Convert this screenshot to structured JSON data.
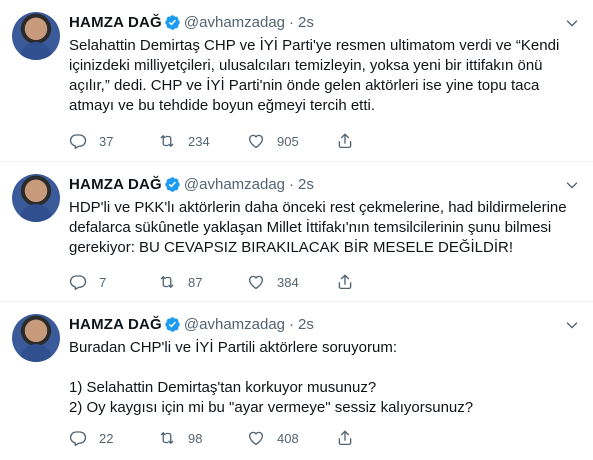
{
  "tweets": [
    {
      "name": "HAMZA DAĞ",
      "handle": "@avhamzadag",
      "dot": "·",
      "time": "2s",
      "text": "Selahattin Demirtaş CHP ve İYİ Parti'ye resmen ultimatom verdi ve “Kendi içinizdeki milliyetçileri, ulusalcıları temizleyin, yoksa yeni bir ittifakın önü açılır,” dedi. CHP ve İYİ Parti'nin önde gelen aktörleri ise yine topu taca atmayı ve bu tehdide boyun eğmeyi tercih etti.",
      "replies": "37",
      "retweets": "234",
      "likes": "905"
    },
    {
      "name": "HAMZA DAĞ",
      "handle": "@avhamzadag",
      "dot": "·",
      "time": "2s",
      "text": "HDP'li ve PKK'lı aktörlerin daha önceki rest çekmelerine, had bildirmelerine defalarca sükûnetle yaklaşan Millet İttifakı'nın temsilcilerinin şunu bilmesi gerekiyor: BU CEVAPSIZ BIRAKILACAK BİR MESELE DEĞİLDİR!",
      "replies": "7",
      "retweets": "87",
      "likes": "384"
    },
    {
      "name": "HAMZA DAĞ",
      "handle": "@avhamzadag",
      "dot": "·",
      "time": "2s",
      "text": "Buradan CHP'li ve İYİ Partili aktörlere soruyorum:\n\n1) Selahattin Demirtaş'tan korkuyor musunuz?\n2) Oy kaygısı için mi bu \"ayar vermeye\" sessiz kalıyorsunuz?",
      "replies": "22",
      "retweets": "98",
      "likes": "408"
    }
  ],
  "icons": {
    "verified": "verified-badge-icon",
    "more": "more-options-icon",
    "reply": "reply-icon",
    "retweet": "retweet-icon",
    "like": "like-icon",
    "share": "share-icon"
  },
  "colors": {
    "accent": "#1d9bf0",
    "secondary_text": "#536471",
    "divider": "#eff3f4"
  }
}
